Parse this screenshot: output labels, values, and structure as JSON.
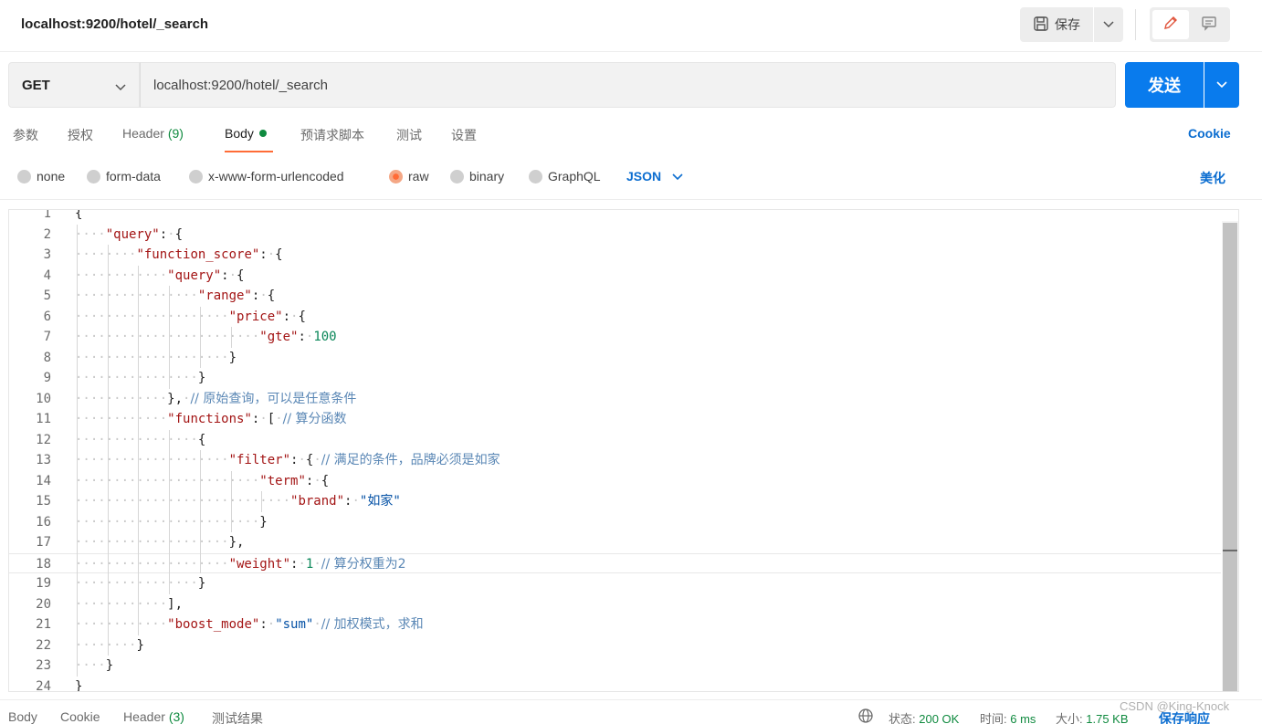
{
  "tab": {
    "title": "localhost:9200/hotel/_search"
  },
  "toolbar": {
    "save_label": "保存"
  },
  "request": {
    "method": "GET",
    "url": "localhost:9200/hotel/_search",
    "send_label": "发送"
  },
  "request_tabs": {
    "params": "参数",
    "auth": "授权",
    "headers": "Header",
    "headers_count": "(9)",
    "body": "Body",
    "pre_request": "预请求脚本",
    "tests": "测试",
    "settings": "设置",
    "cookie": "Cookie"
  },
  "body_types": {
    "none": "none",
    "form_data": "form-data",
    "urlencoded": "x-www-form-urlencoded",
    "raw": "raw",
    "binary": "binary",
    "graphql": "GraphQL",
    "selected": "raw",
    "format": "JSON",
    "beautify": "美化"
  },
  "editor": {
    "lines": [
      {
        "n": "1",
        "text": "{"
      },
      {
        "n": "2",
        "text": "    \"query\": {"
      },
      {
        "n": "3",
        "text": "        \"function_score\": {"
      },
      {
        "n": "4",
        "text": "            \"query\": {"
      },
      {
        "n": "5",
        "text": "                \"range\": {"
      },
      {
        "n": "6",
        "text": "                    \"price\": {"
      },
      {
        "n": "7",
        "text": "                        \"gte\": 100"
      },
      {
        "n": "8",
        "text": "                    }"
      },
      {
        "n": "9",
        "text": "                }"
      },
      {
        "n": "10",
        "text": "            }, // 原始查询，可以是任意条件"
      },
      {
        "n": "11",
        "text": "            \"functions\": [ // 算分函数"
      },
      {
        "n": "12",
        "text": "                {"
      },
      {
        "n": "13",
        "text": "                    \"filter\": { // 满足的条件，品牌必须是如家"
      },
      {
        "n": "14",
        "text": "                        \"term\": {"
      },
      {
        "n": "15",
        "text": "                            \"brand\": \"如家\""
      },
      {
        "n": "16",
        "text": "                        }"
      },
      {
        "n": "17",
        "text": "                    },"
      },
      {
        "n": "18",
        "text": "                    \"weight\": 1 // 算分权重为2"
      },
      {
        "n": "19",
        "text": "                }"
      },
      {
        "n": "20",
        "text": "            ],"
      },
      {
        "n": "21",
        "text": "            \"boost_mode\": \"sum\" // 加权模式，求和"
      },
      {
        "n": "22",
        "text": "        }"
      },
      {
        "n": "23",
        "text": "    }"
      },
      {
        "n": "24",
        "text": "}"
      }
    ],
    "current_line": "18"
  },
  "response": {
    "tabs": {
      "body": "Body",
      "cookie": "Cookie",
      "headers": "Header",
      "headers_count": "(3)",
      "tests": "测试结果"
    },
    "status_label": "状态:",
    "status_value": "200 OK",
    "time_label": "时间:",
    "time_value": "6 ms",
    "size_label": "大小:",
    "size_value": "1.75 KB",
    "save_label": "保存响应"
  },
  "watermark": "CSDN @King-Knock",
  "colors": {
    "accent": "#097bed",
    "tab_underline": "#ff6c37",
    "success": "#0f8a3f"
  },
  "icons": [
    "save-icon",
    "chevron-down-icon",
    "edit-icon",
    "comment-icon",
    "globe-icon"
  ]
}
